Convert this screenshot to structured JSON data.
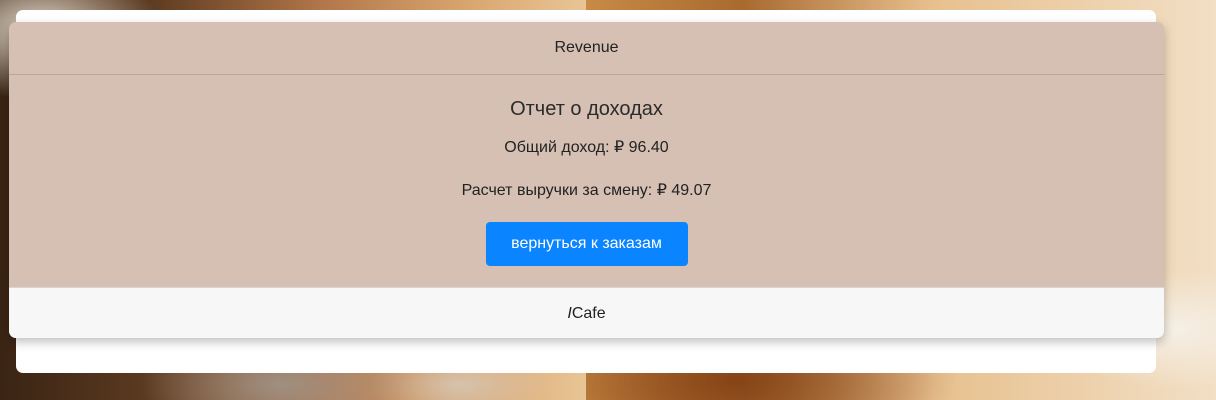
{
  "card": {
    "header_title": "Revenue",
    "report_title": "Отчет о доходах",
    "total_label": "Общий доход:",
    "total_value": "₽ 96.40",
    "shift_label": "Расчет выручки за смену:",
    "shift_value": "₽ 49.07",
    "back_button_label": "вернуться к заказам",
    "footer_brand_prefix": "I",
    "footer_brand_suffix": "Cafe"
  },
  "colors": {
    "card_background": "#d6c0b3",
    "button_background": "#0a84ff",
    "footer_background": "#f7f7f7"
  }
}
